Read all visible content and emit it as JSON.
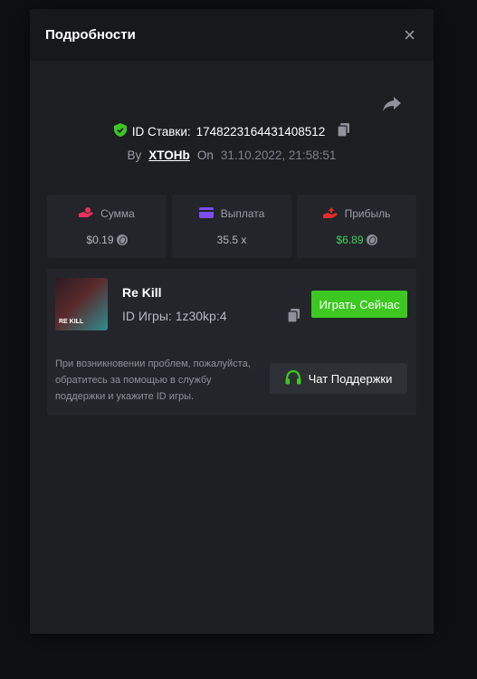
{
  "modal": {
    "title": "Подробности",
    "close_icon": "×"
  },
  "bet": {
    "id_label": "ID Ставки:",
    "id_value": "1748223164431408512",
    "by_label": "By",
    "user": "XTOHb",
    "on_label": "On",
    "date": "31.10.2022, 21:58:51"
  },
  "stats": [
    {
      "label": "Сумма",
      "value": "$0.19",
      "icon": "money-hand-icon",
      "color": "#e8315d"
    },
    {
      "label": "Выплата",
      "value": "35.5 x",
      "icon": "wallet-icon",
      "color": "#7b4ef0"
    },
    {
      "label": "Прибыль",
      "value": "$6.89",
      "icon": "profit-icon",
      "color": "#e82b2b"
    }
  ],
  "game": {
    "thumb_text": "RE KILL",
    "name": "Re Kill",
    "id_label": "ID Игры:",
    "id_value": "1z30kp:4",
    "play_label": "Играть Сейчас"
  },
  "support": {
    "text": "При возникновении проблем, пожалуйста, обратитесь за помощью в службу поддержки и укажите ID игры.",
    "button_label": "Чат Поддержки"
  },
  "colors": {
    "accent_green": "#3cc821",
    "profit_green": "#3fd15a",
    "shield_green": "#3cc821"
  }
}
